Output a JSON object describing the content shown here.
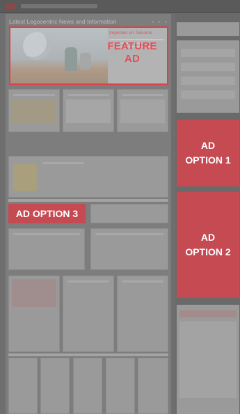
{
  "site": {
    "section_title": "Latest Legocentric News and Information"
  },
  "featured": {
    "headline": "Imperials on Tatooine",
    "ad_label_line1": "FEATURE",
    "ad_label_line2": "AD"
  },
  "ads": {
    "option1_line1": "AD",
    "option1_line2": "OPTION 1",
    "option2_line1": "AD",
    "option2_line2": "OPTION 2",
    "option3": "AD OPTION 3"
  },
  "colors": {
    "ad_red": "#c54a52",
    "feature_red": "#e84c56",
    "overlay_gray": "#7d7d7d"
  }
}
